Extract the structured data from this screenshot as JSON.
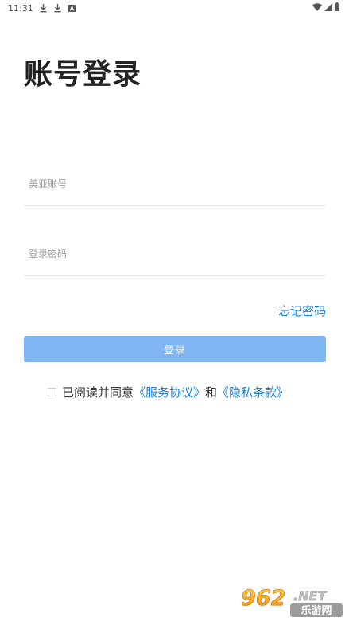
{
  "status_bar": {
    "time": "11:31",
    "notification_icons": [
      "download-icon",
      "download-icon",
      "a-square-icon"
    ],
    "system_icons": [
      "wifi-icon",
      "signal-icon",
      "battery-icon"
    ]
  },
  "title": "账号登录",
  "form": {
    "account_placeholder": "美亚账号",
    "account_value": "",
    "password_placeholder": "登录密码",
    "password_value": ""
  },
  "forgot_password_label": "忘记密码",
  "login_button_label": "登录",
  "agreement": {
    "checked": false,
    "prefix_text": "已阅读并同意",
    "service_link": "《服务协议》",
    "joiner_text": "和",
    "privacy_link": "《隐私条款》"
  },
  "watermark": {
    "brand_number": "962",
    "brand_suffix": ".NET",
    "brand_cn": "乐游网"
  },
  "colors": {
    "link_blue": "#1a7fd6",
    "button_blue": "#7fb6f3",
    "divider": "#e6e6e6"
  }
}
